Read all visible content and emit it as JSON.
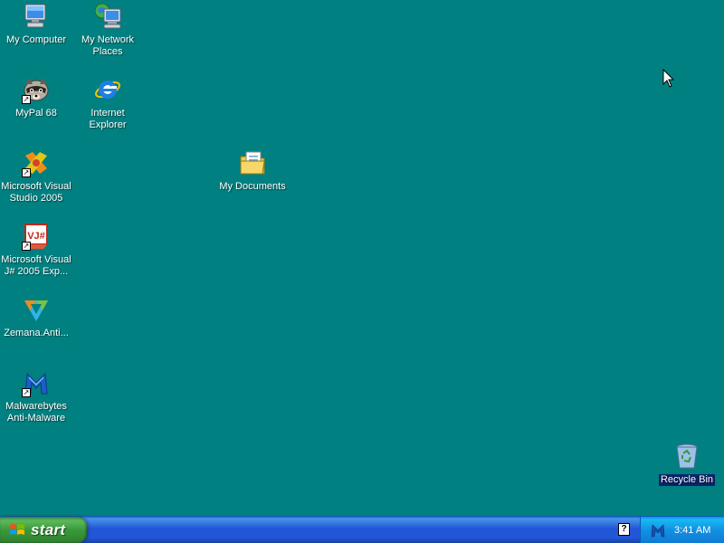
{
  "desktop": {
    "background_color": "#008080",
    "icons": [
      {
        "label": "My Computer",
        "icon": "my-computer-icon",
        "shortcut": false
      },
      {
        "label": "My Network\nPlaces",
        "icon": "network-places-icon",
        "shortcut": false
      },
      {
        "label": "MyPal 68",
        "icon": "mypal-raccoon-icon",
        "shortcut": true
      },
      {
        "label": "Internet\nExplorer",
        "icon": "internet-explorer-icon",
        "shortcut": false
      },
      {
        "label": "Microsoft Visual\nStudio 2005",
        "icon": "visual-studio-icon",
        "shortcut": true
      },
      {
        "label": "My Documents",
        "icon": "my-documents-folder-icon",
        "shortcut": false
      },
      {
        "label": "Microsoft Visual\nJ# 2005 Exp...",
        "icon": "visual-jsharp-icon",
        "shortcut": true
      },
      {
        "label": "Zemana.Anti...",
        "icon": "zemana-icon",
        "shortcut": false
      },
      {
        "label": "Malwarebytes\nAnti-Malware",
        "icon": "malwarebytes-icon",
        "shortcut": true
      },
      {
        "label": "Recycle Bin",
        "icon": "recycle-bin-icon",
        "shortcut": false
      }
    ]
  },
  "taskbar": {
    "start_label": "start",
    "help_icon_glyph": "?",
    "tray_icons": [
      "malwarebytes-tray-icon"
    ],
    "clock": "3:41 AM"
  },
  "colors": {
    "taskbar_blue": "#2157d7",
    "start_green": "#3a9a3a",
    "tray_blue": "#1291e3",
    "selection": "#0a246a"
  }
}
